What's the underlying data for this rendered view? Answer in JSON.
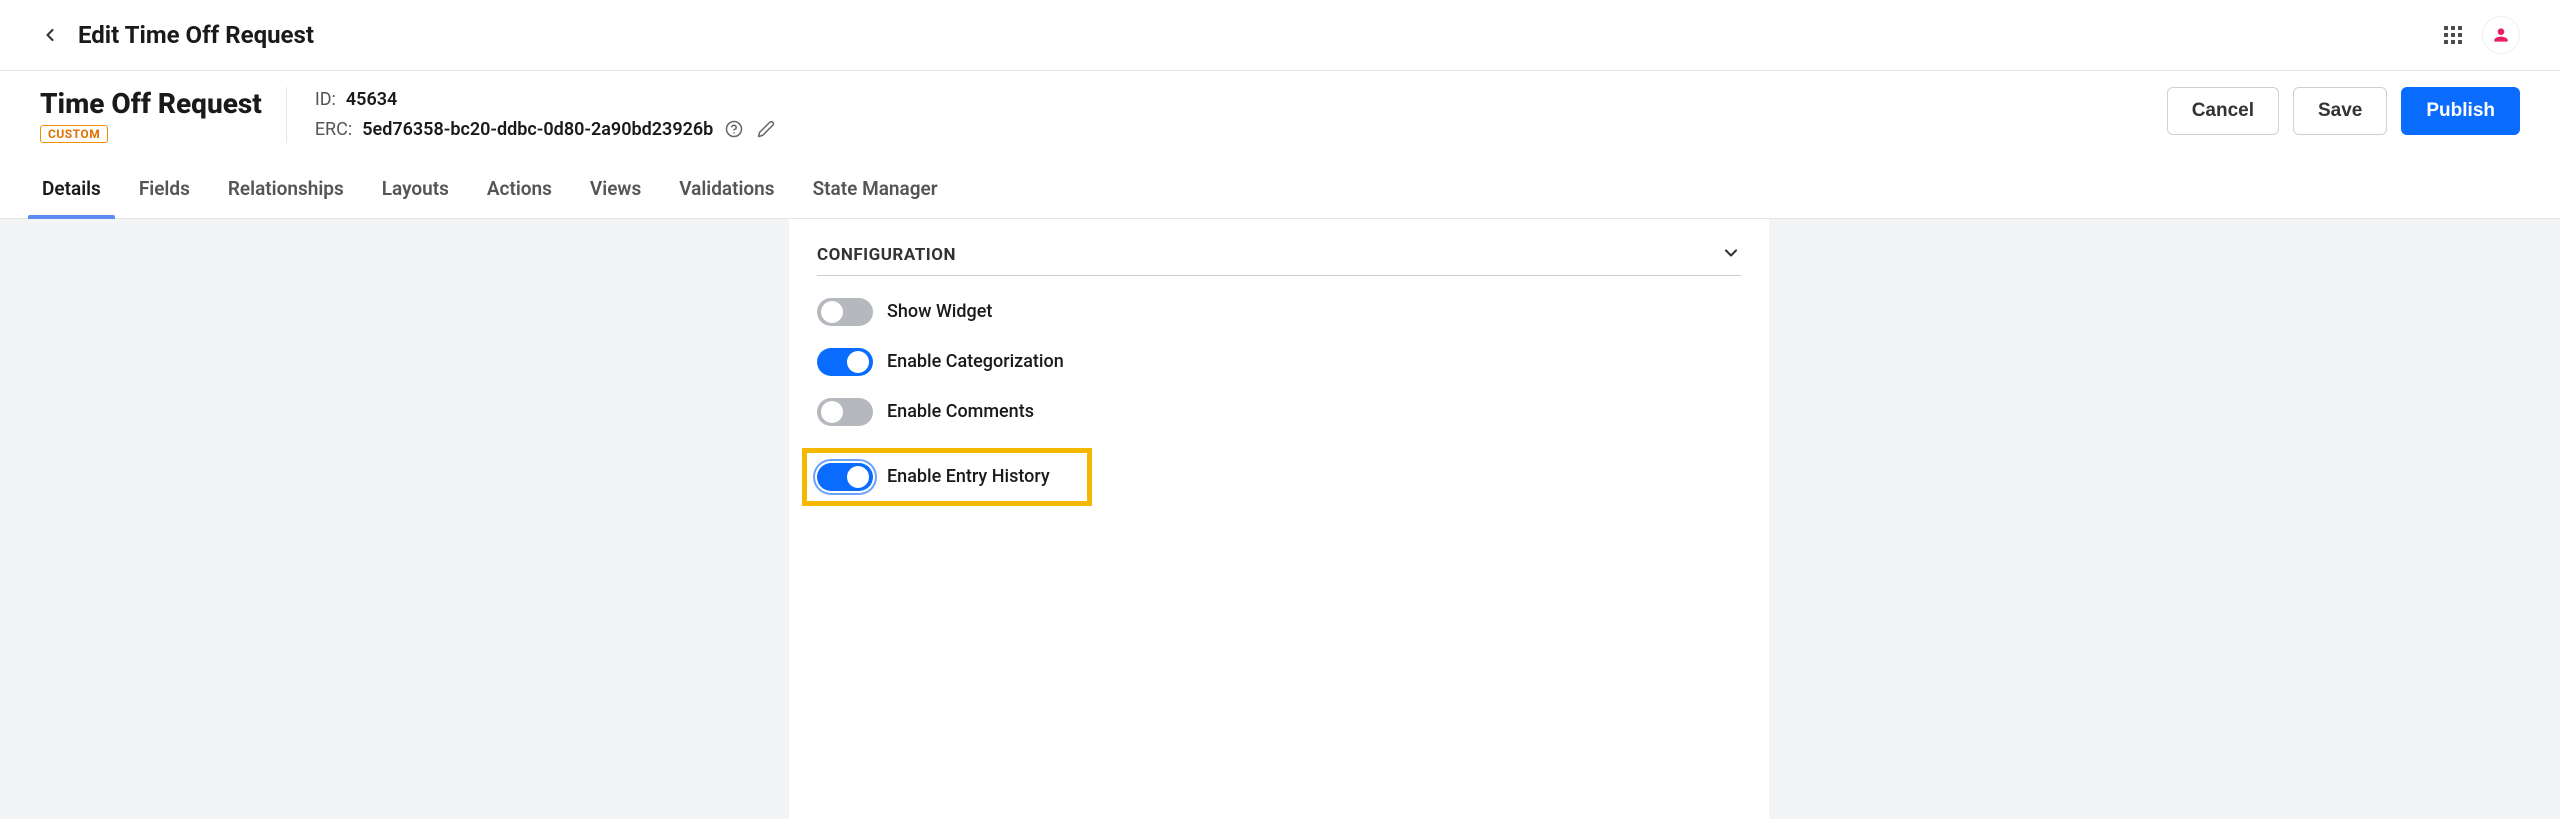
{
  "topbar": {
    "title": "Edit Time Off Request"
  },
  "header": {
    "object_name": "Time Off Request",
    "badge": "CUSTOM",
    "id_label": "ID:",
    "id_value": "45634",
    "erc_label": "ERC:",
    "erc_value": "5ed76358-bc20-ddbc-0d80-2a90bd23926b",
    "actions": {
      "cancel": "Cancel",
      "save": "Save",
      "publish": "Publish"
    }
  },
  "tabs": [
    {
      "label": "Details",
      "active": true
    },
    {
      "label": "Fields",
      "active": false
    },
    {
      "label": "Relationships",
      "active": false
    },
    {
      "label": "Layouts",
      "active": false
    },
    {
      "label": "Actions",
      "active": false
    },
    {
      "label": "Views",
      "active": false
    },
    {
      "label": "Validations",
      "active": false
    },
    {
      "label": "State Manager",
      "active": false
    }
  ],
  "configuration": {
    "title": "CONFIGURATION",
    "items": [
      {
        "label": "Show Widget",
        "on": false,
        "highlight": false
      },
      {
        "label": "Enable Categorization",
        "on": true,
        "highlight": false
      },
      {
        "label": "Enable Comments",
        "on": false,
        "highlight": false
      },
      {
        "label": "Enable Entry History",
        "on": true,
        "highlight": true
      }
    ]
  }
}
